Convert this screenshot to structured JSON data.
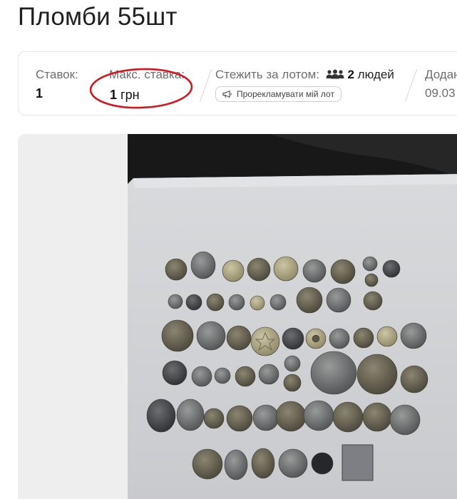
{
  "lot": {
    "title": "Пломби 55шт"
  },
  "stats": {
    "bids_label": "Ставок:",
    "bids_value": "1",
    "max_bid_label": "Макс. ставка:",
    "max_bid_amount": "1",
    "max_bid_currency": "грн",
    "watch_label": "Стежить за лотом:",
    "watch_count": "2",
    "watch_unit": "людей",
    "added_label": "Додано",
    "added_value": "09.03"
  },
  "promote": {
    "label": "Прорекламувати мій лот"
  },
  "annotation": {
    "color": "#d0161f"
  },
  "icons": {
    "people": "people-icon",
    "megaphone": "megaphone-icon"
  }
}
